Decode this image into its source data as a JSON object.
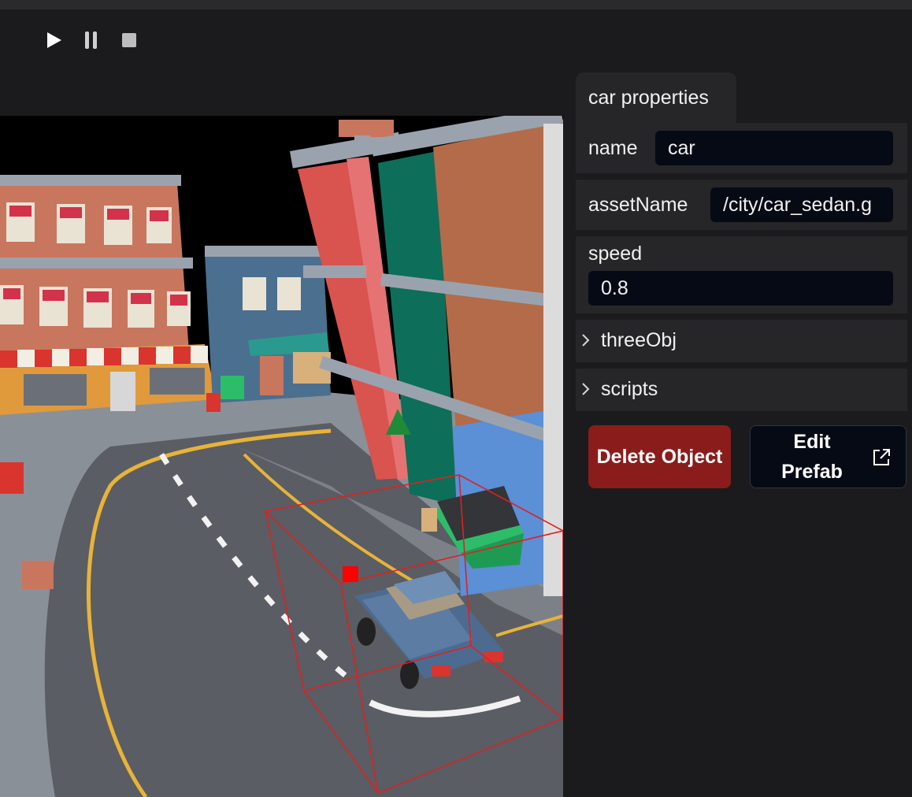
{
  "toolbar": {
    "play_icon": "play-icon",
    "pause_icon": "pause-icon",
    "stop_icon": "stop-icon"
  },
  "panel": {
    "tab_title": "car properties",
    "fields": {
      "name": {
        "label": "name",
        "value": "car"
      },
      "assetName": {
        "label": "assetName",
        "value": "/city/car_sedan.g"
      },
      "speed": {
        "label": "speed",
        "value": "0.8"
      }
    },
    "sections": {
      "threeObj": {
        "label": "threeObj",
        "expanded": false
      },
      "scripts": {
        "label": "scripts",
        "expanded": false
      }
    },
    "buttons": {
      "delete": "Delete Object",
      "edit_prefab": "Edit Prefab"
    },
    "icons": {
      "chevron": "chevron-right-icon",
      "external": "external-link-icon"
    }
  },
  "colors": {
    "accent_danger": "#8b1c1c",
    "panel_bg": "#262629",
    "input_bg": "#060a14",
    "selection": "#e02020"
  }
}
